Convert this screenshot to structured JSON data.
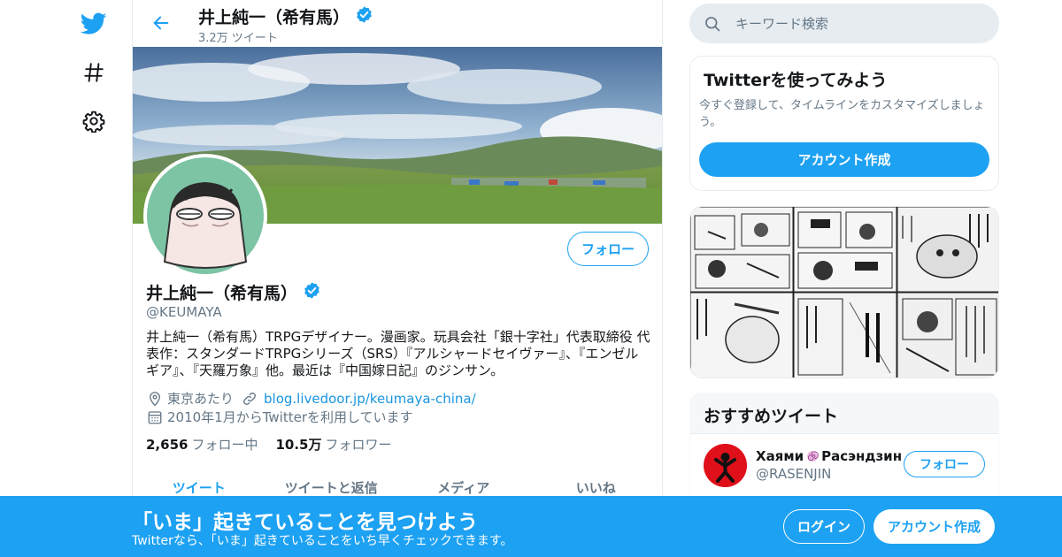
{
  "nav": {
    "icons": [
      "twitter-bird-icon",
      "hashtag-icon",
      "gear-icon"
    ]
  },
  "header": {
    "name": "井上純一（希有馬）",
    "tweet_count": "3.2万 ツイート"
  },
  "profile": {
    "follow_label": "フォロー",
    "name": "井上純一（希有馬）",
    "handle": "@KEUMAYA",
    "bio": "井上純一（希有馬）TRPGデザイナー。漫画家。玩具会社「銀十字社」代表取締役 代表作：スタンダードTRPGシリーズ（SRS）『アルシャードセイヴァー』、『エンゼルギア』、『天羅万象』他。最近は『中国嫁日記』のジンサン。",
    "location": "東京あたり",
    "website": "blog.livedoor.jp/keumaya-china/",
    "joined": "2010年1月からTwitterを利用しています",
    "following_count": "2,656",
    "following_label": "フォロー中",
    "followers_count": "10.5万",
    "followers_label": "フォロワー"
  },
  "tabs": [
    {
      "label": "ツイート"
    },
    {
      "label": "ツイートと返信"
    },
    {
      "label": "メディア"
    },
    {
      "label": "いいね"
    }
  ],
  "search": {
    "placeholder": "キーワード検索"
  },
  "signup_card": {
    "title": "Twitterを使ってみよう",
    "description": "今すぐ登録して、タイムラインをカスタマイズしましょう。",
    "button": "アカウント作成"
  },
  "recommend": {
    "title": "おすすめツイート",
    "name": "Хаями",
    "name_rest": "Расэндзин",
    "handle": "@RASENJIN",
    "follow_label": "フォロー"
  },
  "bottom_bar": {
    "title": "「いま」起きていることを見つけよう",
    "subtitle": "Twitterなら、「いま」起きていることをいち早くチェックできます。",
    "login": "ログイン",
    "signup": "アカウント作成"
  },
  "colors": {
    "accent": "#1da1f2",
    "text": "#14171a",
    "secondary": "#657786",
    "border": "#e6ecf0"
  }
}
